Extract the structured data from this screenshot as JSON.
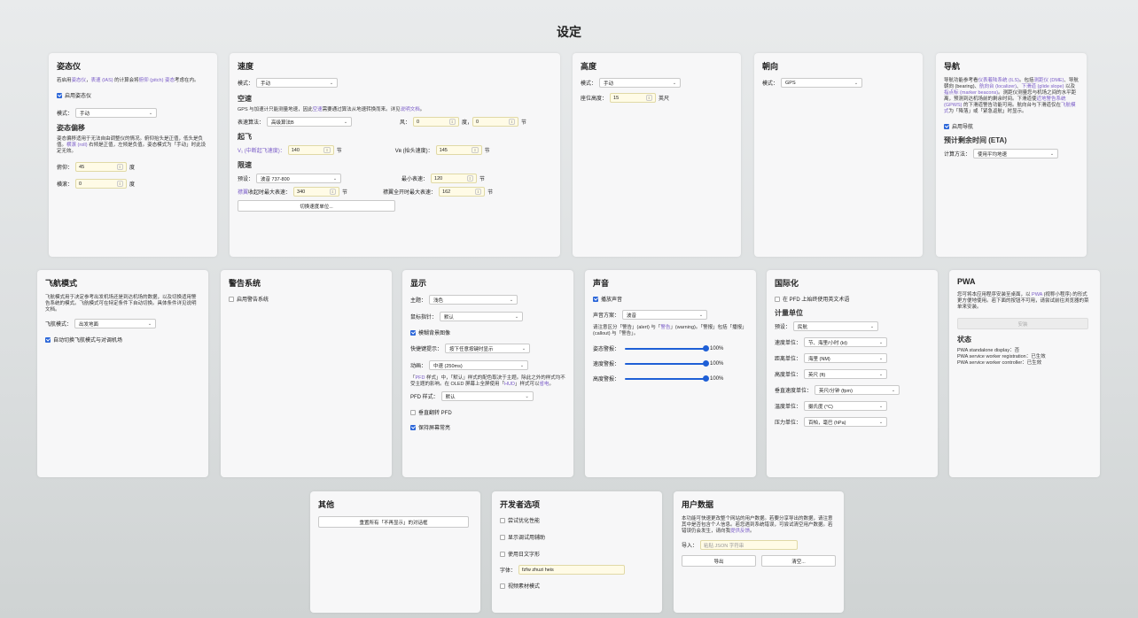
{
  "title": "设定",
  "attitude": {
    "heading": "姿态仪",
    "desc_pre": "若启用",
    "desc_link1": "姿态仪",
    "desc_mid1": "，",
    "desc_link2": "表速 (IAS)",
    "desc_mid2": " 的计算会将",
    "desc_link3": "俯仰 (pitch) 姿态",
    "desc_post": "考虑在内。",
    "enable_label": "启用姿态仪",
    "mode_label": "模式：",
    "mode_value": "手动",
    "offset_heading": "姿态偏移",
    "offset_desc_pre": "姿态偏移适用于无法自由调整仪的情况。俯仰抬头是正值，低头是负值。",
    "offset_desc_link": "横滚 (roll)",
    "offset_desc_post": " 右倾是正值，左倾是负值。姿态模式为「手动」时此设定无效。",
    "pitch_label": "俯仰：",
    "pitch_value": "45",
    "roll_label": "横滚：",
    "roll_value": "0",
    "unit_deg": "度"
  },
  "speed": {
    "heading": "速度",
    "mode_label": "模式：",
    "mode_value": "手动",
    "airspeed_heading": "空速",
    "airspeed_desc_pre": "GPS 与加速计只能测量地速，因此",
    "airspeed_desc_link1": "空速",
    "airspeed_desc_mid": "需要通过算法从地速转换而来。详见",
    "airspeed_desc_link2": "说明文档",
    "airspeed_desc_post": "。",
    "algo_label": "表速算法：",
    "algo_value": "高级算法B",
    "wind_label": "风：",
    "wind_value1": "0",
    "wind_unit1": "度，",
    "wind_value2": "0",
    "wind_unit2": "节",
    "takeoff_heading": "起飞",
    "v1_label": "V₁ (中断起飞速度)：",
    "v1_value": "140",
    "vr_label": "Vʀ (抬头速度)：",
    "vr_value": "145",
    "unit_kt": "节",
    "limit_heading": "限速",
    "preset_label": "预设：",
    "preset_value": "波音 737-800",
    "min_label": "最小表速：",
    "min_value": "120",
    "flaps_label_link": "襟翼",
    "flaps_label_post": "收起时最大表速：",
    "flaps_value": "340",
    "flaps_full_label": "襟翼全开时最大表速：",
    "flaps_full_value": "162",
    "switch_button": "切换速度单位..."
  },
  "altitude": {
    "heading": "高度",
    "mode_label": "模式：",
    "mode_value": "手动",
    "airport_label": "座位高度：",
    "airport_value": "15",
    "unit_ft": "英尺"
  },
  "heading_card": {
    "heading": "朝向",
    "mode_label": "模式：",
    "mode_value": "GPS"
  },
  "nav": {
    "heading": "导航",
    "desc_pre": "导航功能参考看",
    "desc_link1": "仪表着陆系统 (ILS)",
    "desc_a": "。包括",
    "desc_link2": "测距仪 (DME)",
    "desc_b": "、导航朝向 (bearing)、",
    "desc_link3": "航向台 (localizer)",
    "desc_c": "、",
    "desc_link4": "下滑道 (glide slope)",
    "desc_d": " 以及",
    "desc_link5": "指点标 (marker beacons)",
    "desc_e": "。测距仪测量您与机场之间的水平距离，预测到达机场前的剩余时间。下滑道使",
    "desc_link6": "近地警告系统 (GPWS)",
    "desc_f": " 的下滑道警告功能可用。航向台与下滑道仅在",
    "desc_link7": "飞航模式",
    "desc_g": "为「降落」或「紧急返航」时显示。",
    "enable_label": "启用导航",
    "eta_heading": "预计剩余时间 (ETA)",
    "method_label": "计算方法：",
    "method_value": "使用平均地速"
  },
  "flight_mode": {
    "heading": "飞航模式",
    "desc": "飞航模式用于决定参考出发机场还是到达机场的数据，以及切换适用警告系统的模式。飞航模式可在特定条件下自动切换。具体条件详见说明文档。",
    "mode_label": "飞航模式：",
    "mode_value": "出发地面",
    "auto_label": "自动切换飞航模式与对调机场"
  },
  "warning": {
    "heading": "警告系统",
    "enable_label": "启用警告系统"
  },
  "display": {
    "heading": "显示",
    "theme_label": "主题：",
    "theme_value": "浅色",
    "cursor_label": "鼠标指针：",
    "cursor_value": "默认",
    "blur_label": "模糊背景图像",
    "hotkey_label": "快捷键提示：",
    "hotkey_value": "按下任意按键时显示",
    "anim_label": "动画：",
    "anim_value": "中速 (250ms)",
    "pfd_desc_pre": "「",
    "pfd_desc_link1": "PFD",
    "pfd_desc_mid1": " 样式」中，「默认」样式的配色取决于主题。除此之外的样式均不受主题的影响。在 OLED 屏幕上全屏使用「",
    "pfd_desc_link2": "HUD",
    "pfd_desc_mid2": "」样式可以",
    "pfd_desc_link3": "省电",
    "pfd_desc_post": "。",
    "pfd_label": "PFD 样式：",
    "pfd_value": "默认",
    "flip_label": "垂直翻转 PFD",
    "keepon_label": "保持屏幕常亮"
  },
  "sound": {
    "heading": "声音",
    "enable_label": "播放声音",
    "scheme_label": "声音方案：",
    "scheme_value": "波音",
    "desc_pre": "请注意区分「警告」(alert) 与「",
    "desc_link": "警告",
    "desc_post": "」(warning)。「警报」包括「播报」(callout) 与「警告」。",
    "s1_label": "姿态警报：",
    "s1_value": "100%",
    "s1_level": 100,
    "s2_label": "速度警报：",
    "s2_value": "100%",
    "s2_level": 100,
    "s3_label": "高度警报：",
    "s3_value": "100%",
    "s3_level": 100
  },
  "i18n": {
    "heading": "国际化",
    "pfd_en_label": "在 PFD 上始终使用英文术语",
    "units_heading": "计量单位",
    "preset_label": "预设：",
    "preset_value": "民航",
    "speed_label": "速度单位：",
    "speed_value": "节、海里/小时 (kt)",
    "dist_label": "距离单位：",
    "dist_value": "海里 (NM)",
    "alt_label": "高度单位：",
    "alt_value": "英尺 (ft)",
    "vs_label": "垂直速度单位：",
    "vs_value": "英尺/分钟 (fpm)",
    "temp_label": "温度单位：",
    "temp_value": "摄氏度 (°C)",
    "press_label": "压力单位：",
    "press_value": "百帕，毫巴 (hPa)"
  },
  "pwa": {
    "heading": "PWA",
    "desc_pre": "您可将本应用程序安装至桌面，以 ",
    "desc_link": "PWA",
    "desc_post": " (视称小程序) 的形式更方便地使用。若下面的按钮不可用，请尝试前往浏览器的菜单来安装。",
    "install_button": "安装",
    "status_heading": "状态",
    "status1": "PWA standalone display：否",
    "status2": "PWA service worker registration：已生效",
    "status3": "PWA service worker controller：已生效"
  },
  "other": {
    "heading": "其他",
    "reset_button": "重置所有「不再显示」的对话框"
  },
  "dev": {
    "heading": "开发者选项",
    "opt1": "尝试优化性能",
    "opt2": "显示调试用辅助",
    "opt3": "使用日文字形",
    "font_label": "字体：",
    "font_value": "fzfw zhuzi heis",
    "opt4": "视频素材模式"
  },
  "userdata": {
    "heading": "用户数据",
    "desc_pre": "本功能可快速更改整个网站的用户数据。若要分享导出的数据，请注意其中是否包含个人信息。若您遇到系统错误，可尝试清空用户数据。若错误仍会发生，请向我",
    "desc_link": "提供反馈",
    "desc_post": "。",
    "import_label": "导入：",
    "import_placeholder": "粘贴 JSON 字符串",
    "export_button": "导出",
    "clear_button": "清空..."
  }
}
